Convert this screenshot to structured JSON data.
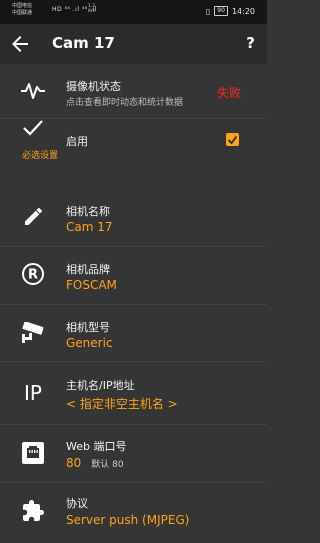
{
  "statusbar": {
    "carrier1": "中国电信",
    "carrier2": "中国联通",
    "network": "HD ⁴⁶ .ıl ⁴⁶ .ıl",
    "speed": "1.2\nK/s",
    "battery": "90",
    "time": "14:20"
  },
  "appbar": {
    "title": "Cam 17",
    "help": "?"
  },
  "rows": {
    "camera_status": {
      "label": "摄像机状态",
      "desc": "点击查看即时动态和统计数据",
      "status": "失败"
    },
    "enabled": {
      "label": "启用",
      "checked": true
    },
    "section_required": "必选设置",
    "camera_name": {
      "label": "相机名称",
      "value": "Cam 17"
    },
    "camera_brand": {
      "label": "相机品牌",
      "value": "FOSCAM"
    },
    "camera_model": {
      "label": "相机型号",
      "value": "Generic"
    },
    "hostname": {
      "label": "主机名/IP地址",
      "value": "< 指定非空主机名 >",
      "icon_text": "IP"
    },
    "web_port": {
      "label": "Web 端口号",
      "value": "80",
      "default": "默认 80"
    },
    "protocol": {
      "label": "协议",
      "value": "Server push (MJPEG)"
    }
  },
  "colors": {
    "accent": "#ffa31a",
    "error": "#ff2a1a",
    "background": "#353535"
  }
}
